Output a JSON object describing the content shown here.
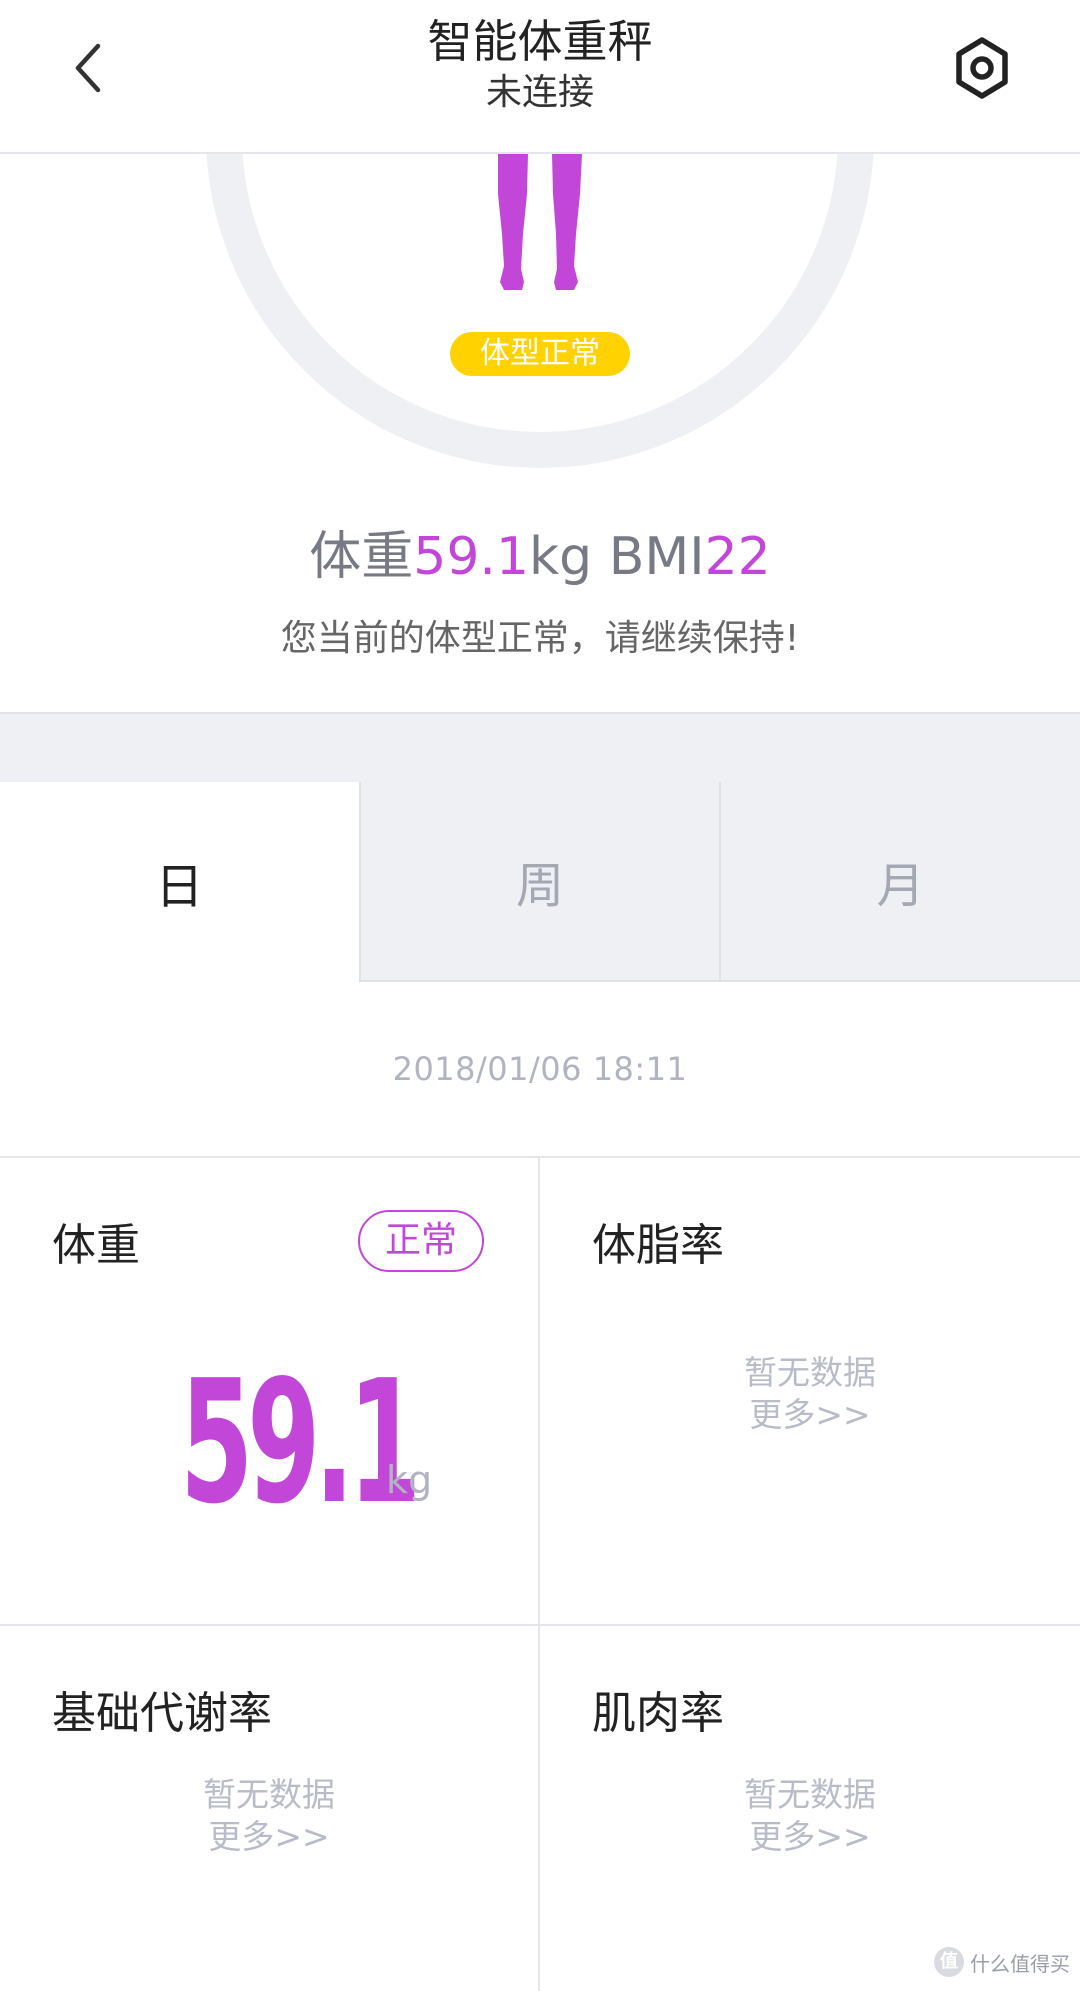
{
  "header": {
    "title": "智能体重秤",
    "subtitle": "未连接",
    "back_icon": "chevron-left-icon",
    "settings_icon": "gear-icon"
  },
  "hero": {
    "body_type_badge": "体型正常",
    "weight_label": "体重",
    "weight_value": "59.1",
    "weight_unit": "kg",
    "bmi_label": "BMI",
    "bmi_value": "22",
    "advice": "您当前的体型正常，请继续保持!"
  },
  "tabs": [
    {
      "label": "日",
      "active": true
    },
    {
      "label": "周",
      "active": false
    },
    {
      "label": "月",
      "active": false
    }
  ],
  "timestamp": "2018/01/06 18:11",
  "metrics": {
    "weight": {
      "title": "体重",
      "status": "正常",
      "value": "59.1",
      "unit": "kg"
    },
    "body_fat": {
      "title": "体脂率",
      "no_data": "暂无数据",
      "more": "更多>>"
    },
    "bmr": {
      "title": "基础代谢率",
      "no_data": "暂无数据",
      "more": "更多>>"
    },
    "muscle": {
      "title": "肌肉率",
      "no_data": "暂无数据",
      "more": "更多>>"
    }
  },
  "watermark": {
    "badge": "值",
    "text": "什么值得买"
  },
  "colors": {
    "accent": "#c247d8",
    "badge_yellow": "#ffd200",
    "ring_gray": "#eef0f4",
    "muted_text": "#b0b4c0"
  }
}
